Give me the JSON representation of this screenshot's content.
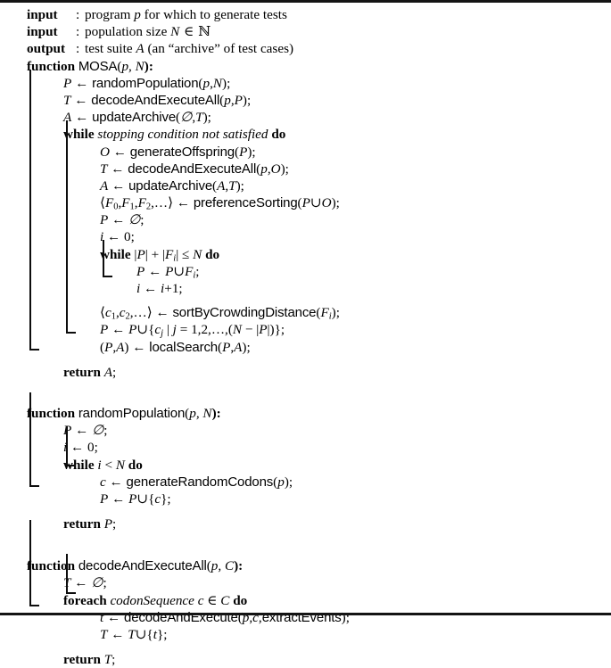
{
  "document": {
    "kind": "algorithm-pseudocode",
    "style": "latex-algorithm2e",
    "rule_color": "#141414"
  },
  "header": {
    "rows": [
      {
        "key": "input",
        "colon": ":",
        "text_prefix": "program ",
        "var": "p",
        "text_suffix": " for which to generate tests"
      },
      {
        "key": "input",
        "colon": ":",
        "text_prefix": "population size ",
        "var": "N",
        "text_suffix": " ∈ ℕ"
      },
      {
        "key": "output",
        "colon": ":",
        "text_prefix": "test suite ",
        "var": "A",
        "text_suffix": " (an “archive” of test cases)"
      }
    ]
  },
  "keywords": {
    "function": "function",
    "while": "while",
    "foreach": "foreach",
    "do": "do",
    "return": "return"
  },
  "functions": {
    "mosa": {
      "name": "MOSA",
      "signature_open": "(",
      "params": "p, N",
      "signature_close": "):",
      "lines": {
        "l1": "P ← randomPopulation(p,N);",
        "l2": "T ← decodeAndExecuteAll(p,P);",
        "l3": "A ← updateArchive(∅,T);",
        "l4_cond": "stopping condition not satisfied",
        "l5": "O ← generateOffspring(P);",
        "l6": "T ← decodeAndExecuteAll(p,O);",
        "l7": "A ← updateArchive(A,T);",
        "l8": "⟨F0,F1,F2,…⟩ ← preferenceSorting(P∪O);",
        "l9": "P ← ∅;",
        "l10": "i ← 0;",
        "l11_cond": "|P| + |Fi| ≤ N",
        "l12": "P ← P∪Fi;",
        "l13": "i ← i+1;",
        "l14": "⟨c1,c2,…⟩ ← sortByCrowdingDistance(Fi);",
        "l15": "P ← P∪{cj | j = 1,2,…,(N − |P|)};",
        "l16": "(P,A) ← localSearch(P,A);",
        "l17": "return A;"
      }
    },
    "randomPopulation": {
      "name": "randomPopulation",
      "signature_open": "(",
      "params": "p, N",
      "signature_close": "):",
      "lines": {
        "l1": "P ← ∅;",
        "l2": "i ← 0;",
        "l3_cond": "i < N",
        "l4": "c ← generateRandomCodons(p);",
        "l5": "P ← P∪{c};",
        "l6": "return P;"
      }
    },
    "decodeAndExecuteAll": {
      "name": "decodeAndExecuteAll",
      "signature_open": "(",
      "params": "p, C",
      "signature_close": "):",
      "lines": {
        "l1": "T ← ∅;",
        "l2_kind": "codonSequence",
        "l2_cond": "c ∈ C",
        "l3": "t ← decodeAndExecute(p,c,extractEvents);",
        "l4": "T ← T∪{t};",
        "l5": "return T;"
      }
    }
  },
  "identifiers": {
    "randomPopulation": "randomPopulation",
    "decodeAndExecuteAll": "decodeAndExecuteAll",
    "updateArchive": "updateArchive",
    "generateOffspring": "generateOffspring",
    "preferenceSorting": "preferenceSorting",
    "sortByCrowdingDistance": "sortByCrowdingDistance",
    "localSearch": "localSearch",
    "generateRandomCodons": "generateRandomCodons",
    "decodeAndExecute": "decodeAndExecute",
    "extractEvents": "extractEvents"
  },
  "symbols": {
    "assign": "←",
    "emptyset": "∅",
    "union": "∪",
    "in": "∈",
    "leq": "≤",
    "naturals": "ℕ",
    "langle": "⟨",
    "rangle": "⟩",
    "ellipsis": "…",
    "minus": "−",
    "mid": "|",
    "semicolon": ";",
    "comma": ",",
    "lt": "<",
    "eq": "=",
    "plus": "+"
  }
}
